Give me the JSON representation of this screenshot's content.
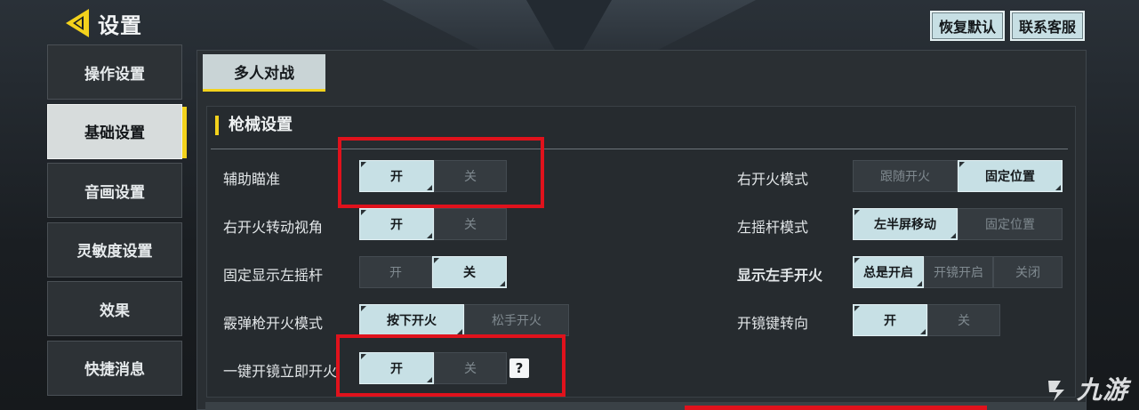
{
  "header": {
    "title": "设置"
  },
  "top_actions": {
    "reset": "恢复默认",
    "support": "联系客服"
  },
  "sidebar": {
    "items": [
      {
        "label": "操作设置",
        "active": false
      },
      {
        "label": "基础设置",
        "active": true
      },
      {
        "label": "音画设置",
        "active": false
      },
      {
        "label": "灵敏度设置",
        "active": false
      },
      {
        "label": "效果",
        "active": false
      },
      {
        "label": "快捷消息",
        "active": false
      }
    ]
  },
  "mode_tab": "多人对战",
  "section": {
    "title": "枪械设置",
    "left": [
      {
        "label": "辅助瞄准",
        "options": [
          "开",
          "关"
        ],
        "selected": 0
      },
      {
        "label": "右开火转动视角",
        "options": [
          "开",
          "关"
        ],
        "selected": 0
      },
      {
        "label": "固定显示左摇杆",
        "options": [
          "开",
          "关"
        ],
        "selected": 1
      },
      {
        "label": "霰弹枪开火模式",
        "options": [
          "按下开火",
          "松手开火"
        ],
        "selected": 0
      },
      {
        "label": "一键开镜立即开火",
        "options": [
          "开",
          "关"
        ],
        "selected": 0,
        "help": "?"
      }
    ],
    "right": [
      {
        "label": "右开火模式",
        "options": [
          "跟随开火",
          "固定位置"
        ],
        "selected": 1
      },
      {
        "label": "左摇杆模式",
        "options": [
          "左半屏移动",
          "固定位置"
        ],
        "selected": 0
      },
      {
        "label": "显示左手开火",
        "options": [
          "总是开启",
          "开镜开启",
          "关闭"
        ],
        "selected": 0
      },
      {
        "label": "开镜键转向",
        "options": [
          "开",
          "关"
        ],
        "selected": 0
      }
    ]
  },
  "watermark": {
    "text": "九游"
  },
  "colors": {
    "accent": "#f3d21c",
    "highlight": "#e0121c",
    "selected": "#c7e0e5"
  }
}
